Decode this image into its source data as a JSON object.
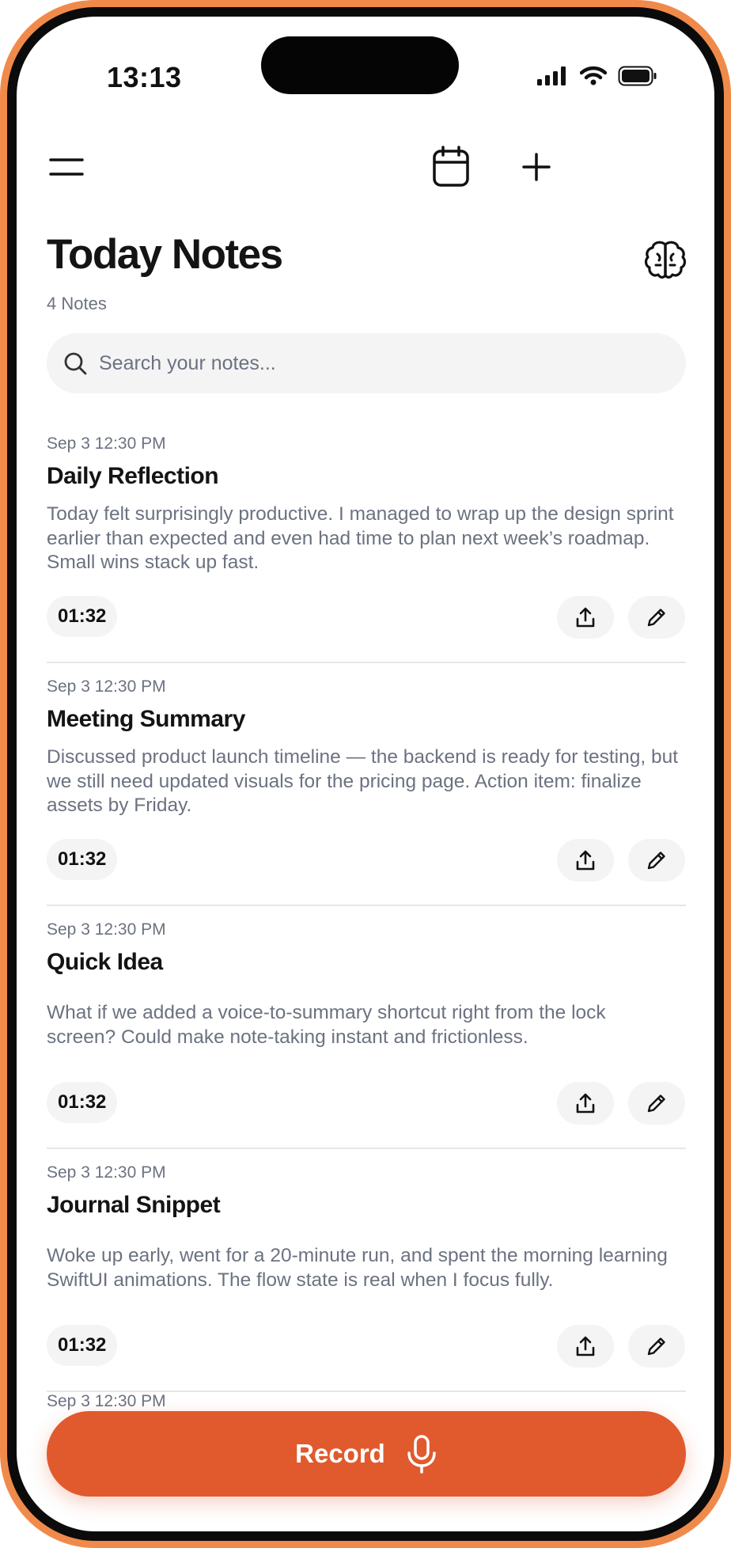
{
  "status": {
    "time": "13:13"
  },
  "header": {
    "title": "Today Notes",
    "count": "4 Notes"
  },
  "search": {
    "placeholder": "Search your notes..."
  },
  "notes": [
    {
      "date": "Sep 3 12:30 PM",
      "title": "Daily Reflection",
      "body": "Today felt surprisingly productive. I managed to wrap up the design sprint earlier than expected and even had time to plan next week’s roadmap. Small wins stack up fast.",
      "duration": "01:32"
    },
    {
      "date": "Sep 3 12:30 PM",
      "title": "Meeting Summary",
      "body": "Discussed product launch timeline — the backend is ready for testing, but we still need updated visuals for the pricing page. Action item: finalize assets by Friday.",
      "duration": "01:32"
    },
    {
      "date": "Sep 3 12:30 PM",
      "title": "Quick Idea",
      "body": "What if we added a voice-to-summary shortcut right from the lock screen? Could make note-taking instant and frictionless.",
      "duration": "01:32"
    },
    {
      "date": "Sep 3 12:30 PM",
      "title": "Journal Snippet",
      "body": "Woke up early, went for a 20-minute run, and spent the morning learning SwiftUI animations. The flow state is real when I focus fully.",
      "duration": "01:32"
    }
  ],
  "peek": {
    "date": "Sep 3 12:30 PM"
  },
  "record": {
    "label": "Record"
  },
  "colors": {
    "accent": "#e05a2e",
    "frame": "#f08a4b"
  },
  "icons": [
    "menu-icon",
    "calendar-icon",
    "plus-icon",
    "brain-icon",
    "search-icon",
    "share-icon",
    "pencil-icon",
    "microphone-icon"
  ]
}
